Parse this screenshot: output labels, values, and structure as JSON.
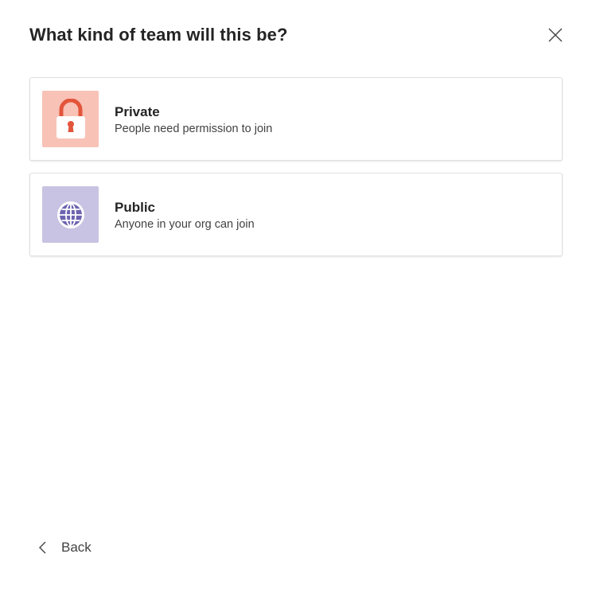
{
  "dialog": {
    "title": "What kind of team will this be?",
    "close_icon": "close-icon"
  },
  "options": [
    {
      "title": "Private",
      "description": "People need permission to join",
      "icon": "lock-icon",
      "icon_bg": "#f8c2b6",
      "icon_color": "#e3553b"
    },
    {
      "title": "Public",
      "description": "Anyone in your org can join",
      "icon": "globe-icon",
      "icon_bg": "#c8c3e2",
      "icon_color": "#6c63b0"
    }
  ],
  "footer": {
    "back_label": "Back",
    "back_icon": "chevron-left-icon"
  }
}
